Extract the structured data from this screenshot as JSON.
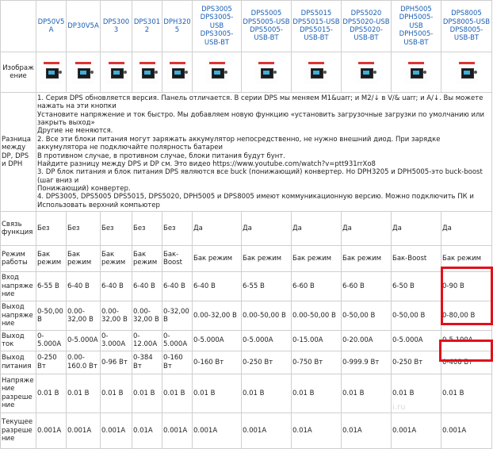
{
  "header_models": [
    "",
    "DP50V5A",
    "DP30V5A",
    "DPS3003",
    "DPS3012",
    "DPH3205",
    "DPS3005\nDPS3005-USB\nDPS3005-USB-BT",
    "DPS5005\nDPS5005-USB\nDPS5005-USB-BT",
    "DPS5015\nDPS5015-USB\nDPS5015-USB-BT",
    "DPS5020\nDPS5020-USB\nDPS5020-USB-BT",
    "DPH5005\nDPH5005-USB\nDPH5005-USB-BT",
    "DPS8005\nDPS8005-USB\nDPS8005-USB-BT"
  ],
  "image_row_label": "Изображение",
  "desc_row_label": "Разница между DP, DPS и DPH",
  "description": [
    "1. Серия DPS обновляется версия. Панель отличается. В серии DPS мы меняем M1&uarr; и M2/↓ в V/& uarr; и A/↓. Вы можете нажать на эти кнопки",
    "Установите напряжение и ток быстро. Мы добавляем новую функцию «установить загрузочные загрузки по умолчанию или закрыть выход»",
    "Другие не меняются.",
    "2. Все эти блоки питания могут заряжать аккумулятор непосредственно, не нужно внешний диод. При зарядке аккумулятора не подключайте полярность батареи",
    "В противном случае, в противном случае, блоки питания будут бунт.",
    "Найдите разницу между DPS и DP см. Это видео https://www.youtube.com/watch?v=ptt931rrXo8",
    "3. DP блок питания и блок питания DPS являются все buck (понижающий) конвертер. Но DPH3205 и DPH5005-это buck-boost (шаг вниз и",
    "Понижающий) конвертер.",
    "4. DPS3005, DPS5005 DPS5015, DPS5020, DPH5005 и DPS8005 имеют коммуникационную версию. Можно подключить ПК и",
    "Использовать верхний компьютер"
  ],
  "rows": [
    {
      "label": "Связь функция",
      "cells": [
        "Без",
        "Без",
        "Без",
        "Без",
        "Без",
        "Да",
        "Да",
        "Да",
        "Да",
        "Да",
        "Да"
      ]
    },
    {
      "label": "Режим работы",
      "cells": [
        "Бак режим",
        "Бак режим",
        "Бак режим",
        "Бак режим",
        "Бак-Boost",
        "Бак режим",
        "Бак режим",
        "Бак режим",
        "Бак режим",
        "Бак-Boost",
        "Бак режим"
      ]
    },
    {
      "label": "Вход напряжение",
      "cells": [
        "6-55 В",
        "6-40 В",
        "6-40 В",
        "6-40 В",
        "6-40 В",
        "6-40 В",
        "6-55 В",
        "6-60 В",
        "6-60 В",
        "6-50 В",
        "0-90 В"
      ]
    },
    {
      "label": "Выход напряжение",
      "cells": [
        "0-50,00 В",
        "0.00-32,00 В",
        "0.00-32,00 В",
        "0.00-32,00 В",
        "0-32,00 В",
        "0.00-32,00 В",
        "0.00-50,00 В",
        "0.00-50,00 В",
        "0-50,00 В",
        "0-50,00 В",
        "0-80,00 В"
      ]
    },
    {
      "label": "Выход ток",
      "cells": [
        "0-5.000A",
        "0-5.000A",
        "0-3.000A",
        "0-12.00A",
        "0-5.000A",
        "0-5.000A",
        "0-5.000A",
        "0-15.00A",
        "0-20.00A",
        "0-5.000A",
        "0-5.100A"
      ]
    },
    {
      "label": "Выход питания",
      "cells": [
        "0-250 Вт",
        "0.00-160.0 Вт",
        "0-96 Вт",
        "0-384 Вт",
        "0-160 Вт",
        "0-160 Вт",
        "0-250 Вт",
        "0-750 Вт",
        "0-999.9 Вт",
        "0-250 Вт",
        "0-408 Вт"
      ]
    },
    {
      "label": "Напряжение разрешение",
      "cells": [
        "0.01 В",
        "0.01 В",
        "0.01 В",
        "0.01 В",
        "0.01 В",
        "0.01 В",
        "0.01 В",
        "0.01 В",
        "0.01 В",
        "0.01 В",
        "0.01 В"
      ]
    },
    {
      "label": "Текущее разрешение",
      "cells": [
        "0.001A",
        "0.001A",
        "0.001A",
        "0.01A",
        "0.001A",
        "0.001A",
        "0.001A",
        "0.01A",
        "0.01A",
        "0.001A",
        "0.001A"
      ]
    }
  ],
  "colors": {
    "highlight": "#e0101a",
    "link": "#1a5fb4",
    "border": "#cfcfcf"
  },
  "watermark": "i.ru"
}
